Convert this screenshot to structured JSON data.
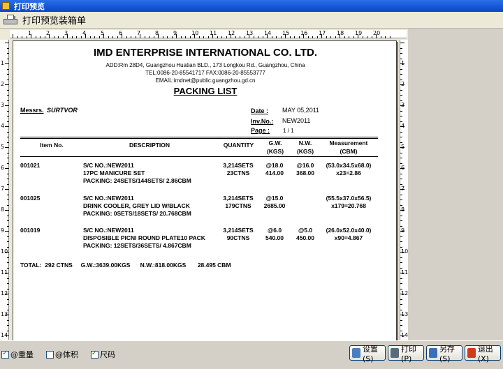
{
  "window": {
    "title": "打印预览"
  },
  "header": {
    "title": "打印预览装箱单"
  },
  "document": {
    "company": "IMD ENTERPRISE INTERNATIONAL CO. LTD.",
    "address": "ADD:Rm 28D4, Guangzhou Huatian BLD., 173 Longkou Rd., Guangzhou, China",
    "tel": "TEL:0086-20-85541717   FAX:0086-20-85553777",
    "email": "EMAIL:imdnet@public.guangzhou.gd.cn",
    "doc_title": "PACKING LIST",
    "messrs_label": "Messrs.",
    "messrs_value": "SURTVOR",
    "date_label": "Date :",
    "date_value": "MAY 05,2011",
    "inv_label": "Inv.No.:",
    "inv_value": "NEW2011",
    "page_label": "Page :",
    "page_value": "1 / 1",
    "columns": {
      "item": "Item No.",
      "desc": "DESCRIPTION",
      "qty": "QUANTITY",
      "gw": "G.W.",
      "gw_unit": "(KGS)",
      "nw": "N.W.",
      "nw_unit": "(KGS)",
      "meas": "Measurement",
      "meas_unit": "(CBM)"
    },
    "rows": [
      {
        "item": "001021",
        "desc1": "S/C NO.:NEW2011",
        "desc2": "17PC MANICURE SET",
        "desc3": "PACKING:   24SETS/144SETS/ 2.86CBM",
        "qty1": "3,214SETS",
        "qty2": "23CTNS",
        "gw1": "@18.0",
        "gw2": "414.00",
        "nw1": "@16.0",
        "nw2": "368.00",
        "meas1": "(53.0x34.5x68.0)",
        "meas2": "x23=2.86"
      },
      {
        "item": "001025",
        "desc1": "S/C NO.:NEW2011",
        "desc2": "DRINK COOLER, GREY LID W/BLACK",
        "desc3": "PACKING:   0SETS/18SETS/ 20.768CBM",
        "qty1": "3,214SETS",
        "qty2": "179CTNS",
        "gw1": "@15.0",
        "gw2": "2685.00",
        "nw1": "",
        "nw2": "",
        "meas1": "(55.5x37.0x56.5)",
        "meas2": "x179=20.768"
      },
      {
        "item": "001019",
        "desc1": "S/C NO.:NEW2011",
        "desc2": "DISPOSIBLE PICNI ROUND PLATE10 PACK",
        "desc3": "PACKING:   12SETS/36SETS/ 4.867CBM",
        "qty1": "3,214SETS",
        "qty2": "90CTNS",
        "gw1": "@6.0",
        "gw2": "540.00",
        "nw1": "@5.0",
        "nw2": "450.00",
        "meas1": "(26.0x52.0x40.0)",
        "meas2": "x90=4.867"
      }
    ],
    "total": "TOTAL:  292 CTNS     G.W.:3639.00KGS      N.W.:818.00KGS       28.495 CBM"
  },
  "ruler": {
    "top_numbers": [
      "1",
      "2",
      "3",
      "4",
      "5",
      "6",
      "7",
      "8",
      "9",
      "10",
      "11",
      "12",
      "13",
      "14",
      "15",
      "16",
      "17",
      "18",
      "19",
      "20"
    ],
    "left_numbers": [
      "1",
      "2",
      "3",
      "4",
      "5",
      "6",
      "7",
      "8",
      "9",
      "10",
      "11",
      "12",
      "13",
      "14"
    ]
  },
  "bottom": {
    "checkboxes": [
      {
        "label": "@重量",
        "checked": true
      },
      {
        "label": "@体积",
        "checked": false
      },
      {
        "label": "尺码",
        "checked": true
      }
    ],
    "buttons": {
      "settings": "设置(S)",
      "print": "打印(P)",
      "saveas": "另存(S)",
      "exit": "退出(X)"
    }
  },
  "colors": {
    "titlebar": "#0a46c8",
    "settings_icon": "#4a7fc0",
    "print_icon": "#5a6a7a",
    "saveas_icon": "#3a70b8",
    "exit_icon": "#d03a20"
  }
}
